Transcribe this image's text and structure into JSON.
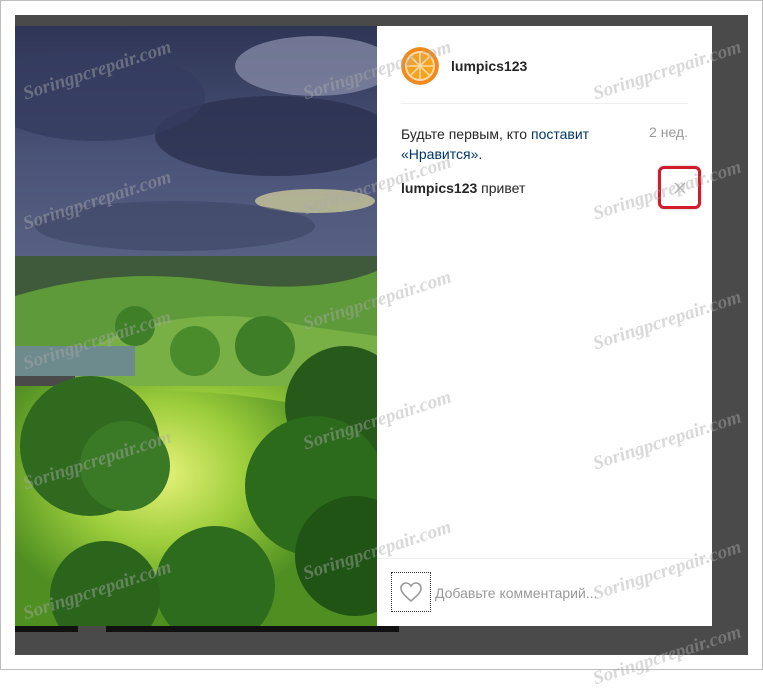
{
  "post": {
    "username": "lumpics123",
    "likes_prefix": "Будьте первым, кто ",
    "likes_link": "поставит «Нравится»",
    "likes_suffix": ".",
    "time_ago": "2 нед.",
    "comment": {
      "user": "lumpics123",
      "text": " привет"
    }
  },
  "footer": {
    "comment_placeholder": "Добавьте комментарий..."
  },
  "icons": {
    "avatar": "orange-slice-icon",
    "delete": "close-icon",
    "like": "heart-icon"
  },
  "colors": {
    "link": "#003569",
    "highlight": "#d11a2a",
    "muted": "#999999"
  },
  "watermark": "Soringpcrepair.com"
}
